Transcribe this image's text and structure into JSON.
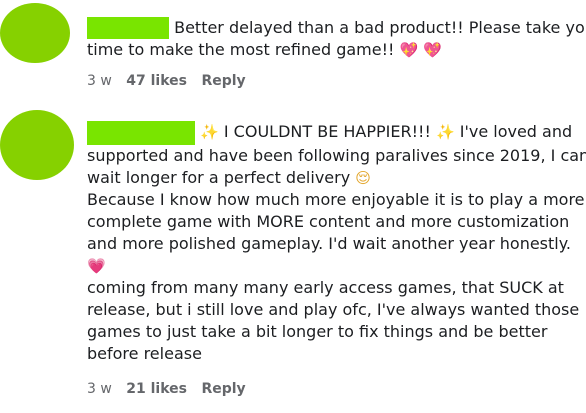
{
  "comments": [
    {
      "text_lines": [
        "Better delayed than a bad product!! Please take your",
        "time to make the most refined game!!"
      ],
      "emoji": [
        "💖",
        "💖"
      ],
      "time": "3 w",
      "likes": "47 likes",
      "reply": "Reply"
    },
    {
      "text_lines": [
        "I COULDNT BE HAPPIER!!!",
        "I've loved and",
        "supported and have been following paralives since 2019, I can",
        "wait longer for a perfect delivery",
        "Because I know how much more enjoyable it is to play a more",
        "complete game with MORE content and more customization",
        "and more polished gameplay. I'd wait another year honestly.",
        "coming from many many early access games, that SUCK at",
        "release, but i still love and play ofc, I've always wanted those",
        "games to just take a bit longer to fix things and be better",
        "before release"
      ],
      "emoji": [
        "✨",
        "✨",
        "😌",
        "💗"
      ],
      "time": "3 w",
      "likes": "21 likes",
      "reply": "Reply"
    }
  ]
}
